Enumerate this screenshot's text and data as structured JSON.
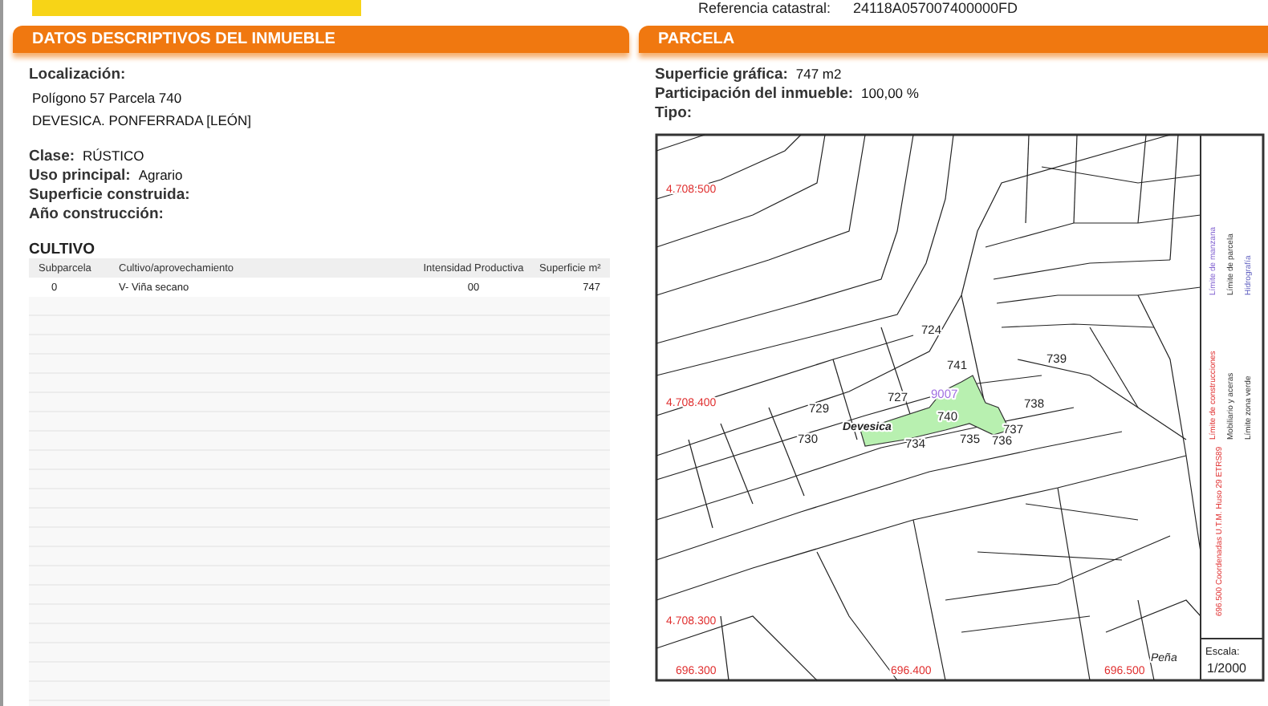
{
  "header": {
    "reference_label": "Referencia catastral:",
    "reference_value": "24118A057007400000FD"
  },
  "left_panel": {
    "title": "DATOS DESCRIPTIVOS DEL INMUEBLE",
    "location_label": "Localización:",
    "location_lines": [
      "Polígono 57 Parcela 740",
      "DEVESICA. PONFERRADA [LEÓN]"
    ],
    "fields": [
      {
        "label": "Clase:",
        "value": "RÚSTICO"
      },
      {
        "label": "Uso principal:",
        "value": "Agrario"
      },
      {
        "label": "Superficie construida:"
      },
      {
        "label": "Año construcción:"
      }
    ],
    "table": {
      "title": "CULTIVO",
      "columns": [
        "Subparcela",
        "Cultivo/aprovechamiento",
        "Intensidad Productiva",
        "Superficie m²"
      ],
      "rows": [
        [
          "0",
          "V- Viña secano",
          "00",
          "747"
        ]
      ]
    }
  },
  "right_panel": {
    "title": "PARCELA",
    "fields": [
      {
        "label": "Superficie gráfica:",
        "value": "747 m2"
      },
      {
        "label": "Participación del inmueble:",
        "value": "100,00 %"
      },
      {
        "label": "Tipo:"
      }
    ],
    "map": {
      "grid_labels": [
        "4.708.500",
        "4.708.400",
        "4.708.300",
        "696.300",
        "696.400",
        "696.500"
      ],
      "parcel_labels": [
        "724",
        "741",
        "739",
        "729",
        "727",
        "740",
        "738",
        "737",
        "730",
        "734",
        "735",
        "736"
      ],
      "special_label": "9007",
      "place_names": [
        "Devesica",
        "Peña"
      ],
      "legend": [
        "Límite de manzana",
        "Límite de parcela",
        "Hidrografía",
        "Límite de construcciones",
        "Mobiliario y aceras",
        "Límite zona verde"
      ],
      "coordinates_note": "696.500 Coordenadas U.T.M. Huso 29 ETRS89",
      "scale_label": "Escala:",
      "scale_value": "1/2000"
    }
  }
}
